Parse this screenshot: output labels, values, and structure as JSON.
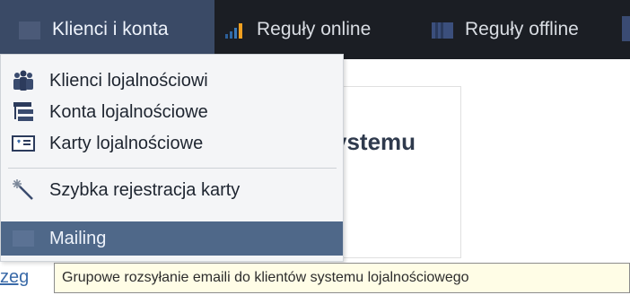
{
  "nav": {
    "tabs": [
      {
        "label": "Klienci i konta",
        "icon": "clients-accounts-icon",
        "active": true
      },
      {
        "label": "Reguły online",
        "icon": "bar-chart-icon",
        "active": false
      },
      {
        "label": "Reguły offline",
        "icon": "offline-rules-icon",
        "active": false
      }
    ]
  },
  "dropdown": {
    "items": [
      {
        "label": "Klienci lojalnościowi",
        "icon": "people-group-icon"
      },
      {
        "label": "Konta lojalnościowe",
        "icon": "tree-list-icon"
      },
      {
        "label": "Karty lojalnościowe",
        "icon": "loyalty-card-icon"
      },
      {
        "label": "Szybka rejestracja karty",
        "icon": "magic-wand-icon"
      },
      {
        "label": "Mailing",
        "icon": "mailing-icon",
        "highlighted": true
      }
    ]
  },
  "background": {
    "title_fragment": "ystemu",
    "link_fragment": "zeg"
  },
  "tooltip": {
    "text": "Grupowe rozsyłanie emaili do klientów systemu lojalnościowego"
  },
  "colors": {
    "topbar": "#1b1e24",
    "active_tab": "#3a4a66",
    "highlight": "#4f6889",
    "tooltip_bg": "#fffde6"
  }
}
